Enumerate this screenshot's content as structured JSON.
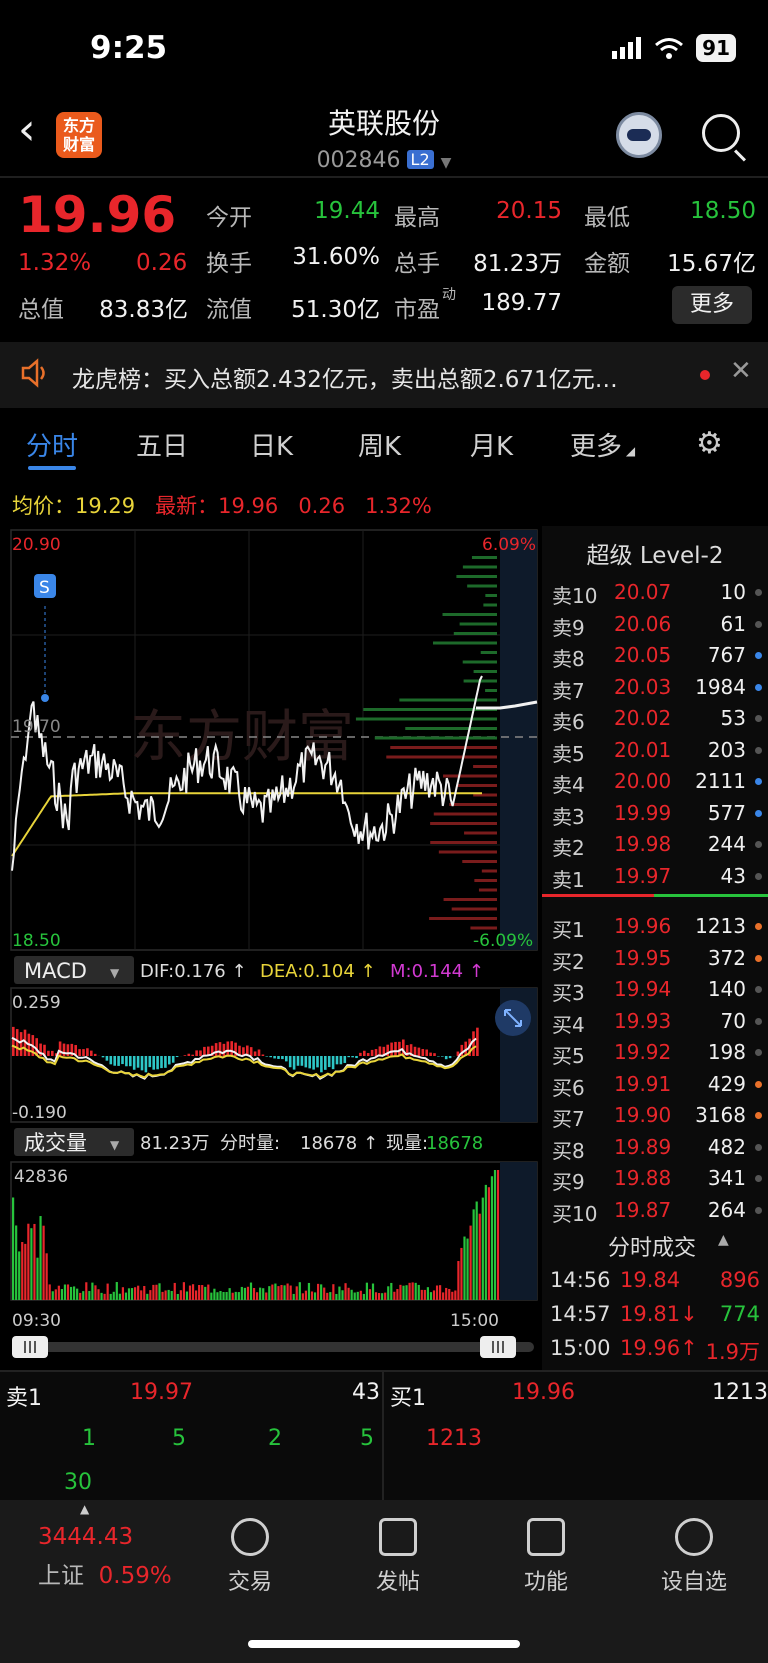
{
  "status_bar": {
    "time": "9:25",
    "battery": "91"
  },
  "header": {
    "logo_text": "东方财富",
    "stock_name": "英联股份",
    "stock_code": "002846",
    "level_badge": "L2"
  },
  "quote": {
    "price": "19.96",
    "pct_change": "1.32%",
    "change": "0.26",
    "fields": [
      {
        "label": "今开",
        "value": "19.44",
        "color": "green"
      },
      {
        "label": "最高",
        "value": "20.15",
        "color": "red"
      },
      {
        "label": "最低",
        "value": "18.50",
        "color": "green"
      },
      {
        "label": "换手",
        "value": "31.60%",
        "color": "white"
      },
      {
        "label": "总手",
        "value": "81.23万",
        "color": "white"
      },
      {
        "label": "金额",
        "value": "15.67亿",
        "color": "white"
      },
      {
        "label": "总值",
        "value": "83.83亿",
        "color": "white"
      },
      {
        "label": "流值",
        "value": "51.30亿",
        "color": "white"
      },
      {
        "label": "市盈",
        "value": "189.77",
        "color": "white",
        "superscript": "动"
      }
    ],
    "more_label": "更多"
  },
  "announcement": {
    "text": "龙虎榜：买入总额2.432亿元，卖出总额2.671亿元…"
  },
  "tabs": [
    "分时",
    "五日",
    "日K",
    "周K",
    "月K",
    "更多"
  ],
  "info_line": {
    "avg_label": "均价：",
    "avg_value": "19.29",
    "latest_label": "最新：",
    "latest_value": "19.96",
    "change": "0.26",
    "pct": "1.32%"
  },
  "price_chart": {
    "y_max": "20.90",
    "y_min": "18.50",
    "pct_max": "6.09%",
    "pct_min": "-6.09%",
    "ref_label": "19.70",
    "marker": "S",
    "watermark": "东方财富",
    "x_start": "09:30",
    "x_end": "15:00"
  },
  "macd": {
    "tab": "MACD",
    "dif": "DIF:0.176 ↑",
    "dea": "DEA:0.104 ↑",
    "m": "M:0.144 ↑",
    "y_max": "0.259",
    "y_min": "-0.190"
  },
  "volume": {
    "tab": "成交量",
    "total": "81.23万",
    "fenshi_label": "分时量:",
    "fenshi_value": "18678 ↑",
    "now_label": "现量:",
    "now_value": "18678",
    "y_max": "42836"
  },
  "level2": {
    "title": "超级 Level-2",
    "asks": [
      {
        "label": "卖10",
        "price": "20.07",
        "vol": "10",
        "dot": "#555"
      },
      {
        "label": "卖9",
        "price": "20.06",
        "vol": "61",
        "dot": "#555"
      },
      {
        "label": "卖8",
        "price": "20.05",
        "vol": "767",
        "dot": "#3a86e8"
      },
      {
        "label": "卖7",
        "price": "20.03",
        "vol": "1984",
        "dot": "#3a86e8"
      },
      {
        "label": "卖6",
        "price": "20.02",
        "vol": "53",
        "dot": "#555"
      },
      {
        "label": "卖5",
        "price": "20.01",
        "vol": "203",
        "dot": "#555"
      },
      {
        "label": "卖4",
        "price": "20.00",
        "vol": "2111",
        "dot": "#3a86e8"
      },
      {
        "label": "卖3",
        "price": "19.99",
        "vol": "577",
        "dot": "#3a86e8"
      },
      {
        "label": "卖2",
        "price": "19.98",
        "vol": "244",
        "dot": "#555"
      },
      {
        "label": "卖1",
        "price": "19.97",
        "vol": "43",
        "dot": "#555"
      }
    ],
    "bids": [
      {
        "label": "买1",
        "price": "19.96",
        "vol": "1213",
        "dot": "#e8702a"
      },
      {
        "label": "买2",
        "price": "19.95",
        "vol": "372",
        "dot": "#e8702a"
      },
      {
        "label": "买3",
        "price": "19.94",
        "vol": "140",
        "dot": "#555"
      },
      {
        "label": "买4",
        "price": "19.93",
        "vol": "70",
        "dot": "#555"
      },
      {
        "label": "买5",
        "price": "19.92",
        "vol": "198",
        "dot": "#555"
      },
      {
        "label": "买6",
        "price": "19.91",
        "vol": "429",
        "dot": "#e8702a"
      },
      {
        "label": "买7",
        "price": "19.90",
        "vol": "3168",
        "dot": "#e8702a"
      },
      {
        "label": "买8",
        "price": "19.89",
        "vol": "482",
        "dot": "#555"
      },
      {
        "label": "买9",
        "price": "19.88",
        "vol": "341",
        "dot": "#555"
      },
      {
        "label": "买10",
        "price": "19.87",
        "vol": "264",
        "dot": "#555"
      }
    ],
    "trades_title": "分时成交",
    "trades": [
      {
        "time": "14:56",
        "price": "19.84",
        "vol": "896",
        "price_color": "#e8262b",
        "vol_color": "#e8262b"
      },
      {
        "time": "14:57",
        "price": "19.81↓",
        "vol": "774",
        "price_color": "#e8262b",
        "vol_color": "#27c33c"
      },
      {
        "time": "15:00",
        "price": "19.96↑",
        "vol": "1.9万",
        "price_color": "#e8262b",
        "vol_color": "#e8262b"
      }
    ]
  },
  "bottom_book": {
    "ask_label": "卖1",
    "ask_price": "19.97",
    "ask_vol": "43",
    "bid_label": "买1",
    "bid_price": "19.96",
    "bid_vol": "1213",
    "ask_queue": [
      "1",
      "5",
      "2",
      "5",
      "30"
    ],
    "bid_queue": [
      "1213"
    ]
  },
  "nav": {
    "index_value": "3444.43",
    "index_name": "上证",
    "index_pct": "0.59%",
    "items": [
      "交易",
      "发帖",
      "功能",
      "设自选"
    ]
  },
  "colors": {
    "red": "#e8262b",
    "green": "#27c33c",
    "yellow": "#e8d43a",
    "blue": "#3a86e8"
  }
}
